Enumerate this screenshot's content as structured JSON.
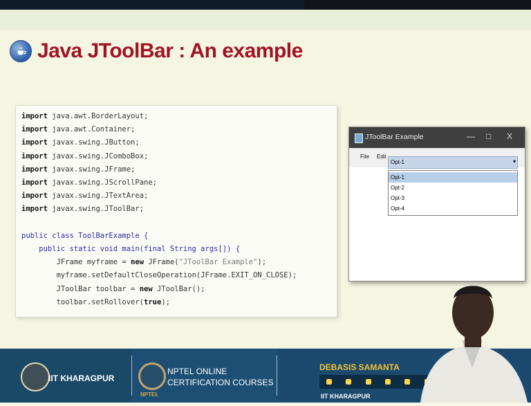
{
  "slide": {
    "title": "Java JToolBar : An example",
    "code_lines": [
      {
        "kw": "import",
        "rest": " java.awt.BorderLayout;"
      },
      {
        "kw": "import",
        "rest": " java.awt.Container;"
      },
      {
        "kw": "import",
        "rest": " javax.swing.JButton;"
      },
      {
        "kw": "import",
        "rest": " javax.swing.JComboBox;"
      },
      {
        "kw": "import",
        "rest": " javax.swing.JFrame;"
      },
      {
        "kw": "import",
        "rest": " javax.swing.JScrollPane;"
      },
      {
        "kw": "import",
        "rest": " javax.swing.JTextArea;"
      },
      {
        "kw": "import",
        "rest": " javax.swing.JToolBar;"
      }
    ],
    "class_line": "public class ToolBarExample {",
    "main_line": "    public static void main(final String args[]) {",
    "frame_line_a": "        JFrame myframe = ",
    "frame_new": "new",
    "frame_line_b": " JFrame(",
    "frame_str": "\"JToolBar Example\"",
    "frame_line_c": ");",
    "close_line": "        myframe.setDefaultCloseOperation(JFrame.EXIT_ON_CLOSE);",
    "toolbar_line_a": "        JToolBar toolbar = ",
    "toolbar_new": "new",
    "toolbar_line_b": " JToolBar();",
    "rollover_line_a": "        toolbar.setRollover(",
    "rollover_true": "true",
    "rollover_line_b": ");"
  },
  "app_window": {
    "title": "JToolBar Example",
    "controls": {
      "minimize": "—",
      "maximize": "□",
      "close": "X"
    },
    "toolbar": {
      "file": "File",
      "edit": "Edit"
    },
    "combo": {
      "selected": "Opt-1",
      "options": [
        "Opt-1",
        "Opt-2",
        "Opt-3",
        "Opt-4"
      ]
    }
  },
  "footer": {
    "institute": "IIT KHARAGPUR",
    "nptel_line1": "NPTEL ONLINE",
    "nptel_line2": "CERTIFICATION COURSES",
    "nptel_sub": "NPTEL",
    "presenter_name": "DEBASIS SAMANTA",
    "presenter_inst": "IIT KHARAGPUR"
  },
  "colors": {
    "title": "#a11322",
    "footer": "#1d4f74",
    "name": "#f1c232"
  }
}
